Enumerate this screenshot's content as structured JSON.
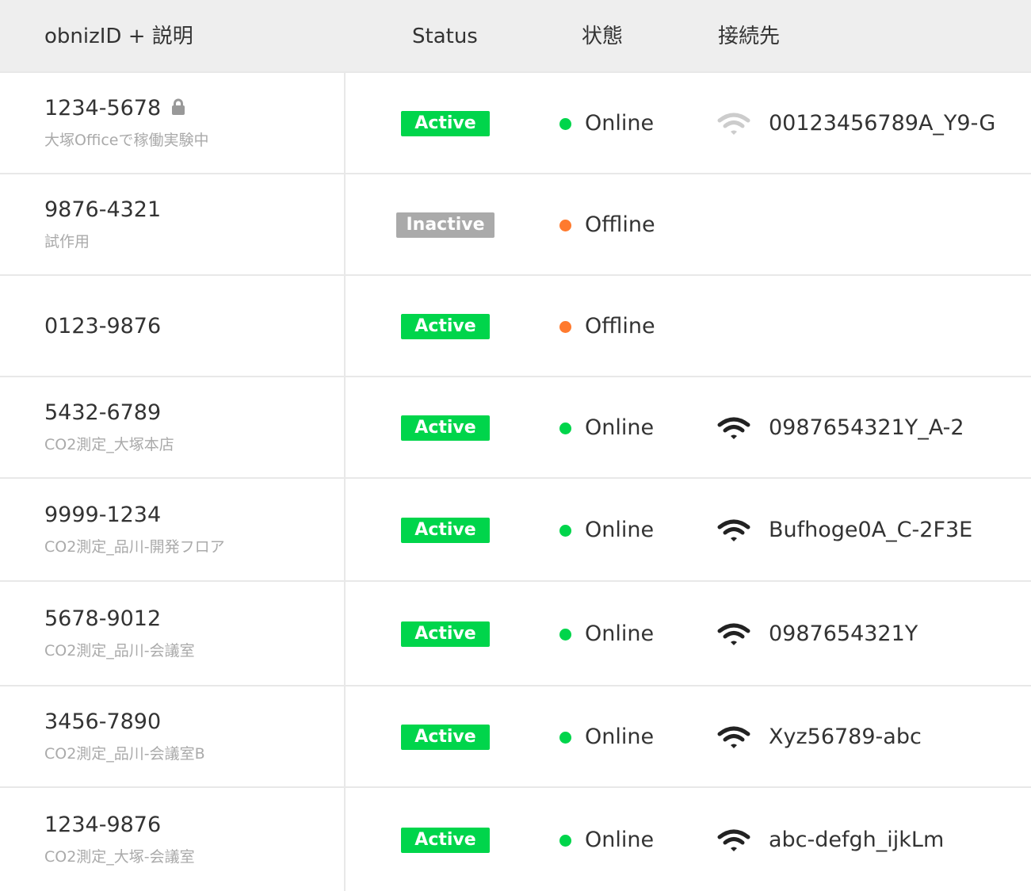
{
  "colors": {
    "active": "#00d54b",
    "inactive": "#aaaaaa",
    "online": "#00d54b",
    "offline": "#ff7a2e",
    "wifi": "#222222",
    "wifi_weak": "#cccccc"
  },
  "header": {
    "id_desc": "obnizID + 説明",
    "status": "Status",
    "state": "状態",
    "connection": "接続先"
  },
  "rows": [
    {
      "id": "1234-5678",
      "locked": true,
      "desc": "大塚Officeで稼働実験中",
      "status": "Active",
      "state": "Online",
      "wifi": "wifi-weak-icon",
      "ssid": "00123456789A_Y9-G"
    },
    {
      "id": "9876-4321",
      "desc": "試作用",
      "status": "Inactive",
      "state": "Offline",
      "ssid": ""
    },
    {
      "id": "0123-9876",
      "desc": "",
      "status": "Active",
      "state": "Offline",
      "ssid": ""
    },
    {
      "id": "5432-6789",
      "desc": "CO2測定_大塚本店",
      "status": "Active",
      "state": "Online",
      "wifi": "wifi-icon",
      "ssid": "0987654321Y_A-2"
    },
    {
      "id": "9999-1234",
      "desc": "CO2測定_品川-開発フロア",
      "status": "Active",
      "state": "Online",
      "wifi": "wifi-icon",
      "ssid": "Bufhoge0A_C-2F3E"
    },
    {
      "id": "5678-9012",
      "desc": "CO2測定_品川-会議室",
      "status": "Active",
      "state": "Online",
      "wifi": "wifi-icon",
      "ssid": "0987654321Y"
    },
    {
      "id": "3456-7890",
      "desc": "CO2測定_品川-会議室B",
      "status": "Active",
      "state": "Online",
      "wifi": "wifi-icon",
      "ssid": "Xyz56789-abc"
    },
    {
      "id": "1234-9876",
      "desc": "CO2測定_大塚-会議室",
      "status": "Active",
      "state": "Online",
      "wifi": "wifi-icon",
      "ssid": "abc-defgh_ijkLm"
    }
  ]
}
